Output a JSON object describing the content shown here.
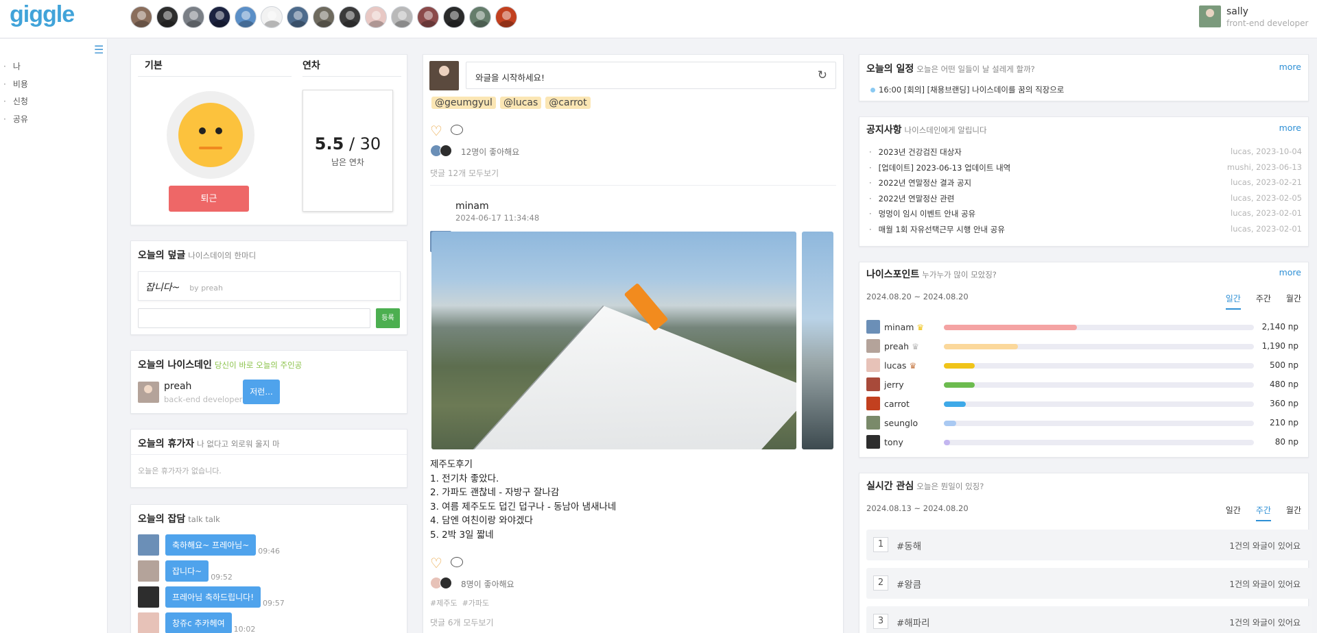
{
  "header": {
    "logo": "giggle",
    "user": {
      "name": "sally",
      "role": "front-end developer"
    },
    "avatar_colors": [
      "#8a6e5c",
      "#2d2d2d",
      "#7a7f86",
      "#1c2340",
      "#5b8fc7",
      "#f2f2f2",
      "#4d6b8c",
      "#6e6a5e",
      "#3a3a3a",
      "#e8c8c4",
      "#b9b9b9",
      "#8b4a4a",
      "#2a2a2a",
      "#657d6b",
      "#c2401f"
    ]
  },
  "sidebar": {
    "items": [
      "나",
      "비용",
      "신청",
      "공유"
    ]
  },
  "status": {
    "tab_basic": "기본",
    "tab_leave": "연차",
    "off_button": "퇴근",
    "leave_used": "5.5",
    "leave_total": "/ 30",
    "leave_label": "남은 연차"
  },
  "comment_of_day": {
    "title": "오늘의 덮글",
    "subtitle": "나이스데이의 한마디",
    "quote": "잡니다~",
    "by": "by preah",
    "submit": "등록"
  },
  "niceday_person": {
    "title": "오늘의 나이스데인",
    "subtitle": "당신이 바로 오늘의 주인공",
    "name": "preah",
    "role": "back-end developer",
    "bubble": "저런..."
  },
  "vacation": {
    "title": "오늘의 휴가자",
    "subtitle": "나 없다고 외로워 울지 마",
    "empty": "오늘은 휴가자가 없습니다."
  },
  "chatter": {
    "title": "오늘의 잡담",
    "subtitle": "talk talk",
    "messages": [
      {
        "text": "축하해요~ 프레아님~",
        "time": "09:46"
      },
      {
        "text": "잡니다~",
        "time": "09:52"
      },
      {
        "text": "프레아님 축하드립니다!",
        "time": "09:57"
      },
      {
        "text": "창쥬c 추카헤여",
        "time": "10:02"
      }
    ]
  },
  "feed": {
    "composer_placeholder": "와글을 시작하세요!",
    "tags": [
      "@geumgyul",
      "@lucas",
      "@carrot"
    ],
    "post1": {
      "likes": "12명이 좋아해요",
      "comments": "댓글 12개 모두보기"
    },
    "post2": {
      "author": "minam",
      "datetime": "2024-06-17 11:34:48",
      "lines": [
        "제주도후기",
        "1. 전기차 좋았다.",
        "2. 가파도 괜찮네 - 자방구 잘나감",
        "3. 여름 제주도도 덥긴 덥구나 - 동남아 냄새나네",
        "4. 담엔 여친이랑 와야겠다",
        "5. 2박 3일 짧네"
      ],
      "likes": "8명이 좋아해요",
      "hashtags": "#제주도  #가파도",
      "comments": "댓글 6개 모두보기"
    }
  },
  "schedule": {
    "title": "오늘의 일정",
    "subtitle": "오늘은 어떤 일들이 날 설레게 할까?",
    "more": "more",
    "item": "16:00 [회의] [채용브랜딩] 나이스데이를 꿈의 직장으로"
  },
  "notices": {
    "title": "공지사항",
    "subtitle": "나이스데인에게 알립니다",
    "more": "more",
    "items": [
      {
        "title": "2023년 건강검진 대상자",
        "meta": "lucas, 2023-10-04"
      },
      {
        "title": "[업데이트] 2023-06-13 업데이트 내역",
        "meta": "mushi, 2023-06-13"
      },
      {
        "title": "2022년 연말정산 결과 공지",
        "meta": "lucas, 2023-02-21"
      },
      {
        "title": "2022년 연말정산 관련",
        "meta": "lucas, 2023-02-05"
      },
      {
        "title": "멍멍이 임시 이벤트 안내 공유",
        "meta": "lucas, 2023-02-01"
      },
      {
        "title": "매월 1회 자유선택근무 시행 안내 공유",
        "meta": "lucas, 2023-02-01"
      }
    ]
  },
  "points": {
    "title": "나이스포인트",
    "subtitle": "누가누가 많이 모았징?",
    "more": "more",
    "range": "2024.08.20 ~ 2024.08.20",
    "tabs": [
      "일간",
      "주간",
      "월간"
    ],
    "rows": [
      {
        "name": "minam",
        "value": "2,140 np",
        "ratio": 0.43,
        "color": "#f4a3a3",
        "crown": "gold"
      },
      {
        "name": "preah",
        "value": "1,190 np",
        "ratio": 0.24,
        "color": "#fbd89b",
        "crown": "silver"
      },
      {
        "name": "lucas",
        "value": "500 np",
        "ratio": 0.1,
        "color": "#f0c419",
        "crown": "bronze"
      },
      {
        "name": "jerry",
        "value": "480 np",
        "ratio": 0.1,
        "color": "#6cbb4f"
      },
      {
        "name": "carrot",
        "value": "360 np",
        "ratio": 0.07,
        "color": "#3ea9e8"
      },
      {
        "name": "seunglo",
        "value": "210 np",
        "ratio": 0.04,
        "color": "#a9c9f2"
      },
      {
        "name": "tony",
        "value": "80 np",
        "ratio": 0.02,
        "color": "#c3b6f0"
      }
    ]
  },
  "trends": {
    "title": "실시간 관심",
    "subtitle": "오늘은 뭔일이 있징?",
    "range": "2024.08.13 ~ 2024.08.20",
    "tabs": [
      "일간",
      "주간",
      "월간"
    ],
    "items": [
      {
        "rank": "1",
        "kw": "#동해",
        "count": "1건의 와글이 있어요"
      },
      {
        "rank": "2",
        "kw": "#왕큼",
        "count": "1건의 와글이 있어요"
      },
      {
        "rank": "3",
        "kw": "#해파리",
        "count": "1건의 와글이 있어요"
      }
    ]
  }
}
